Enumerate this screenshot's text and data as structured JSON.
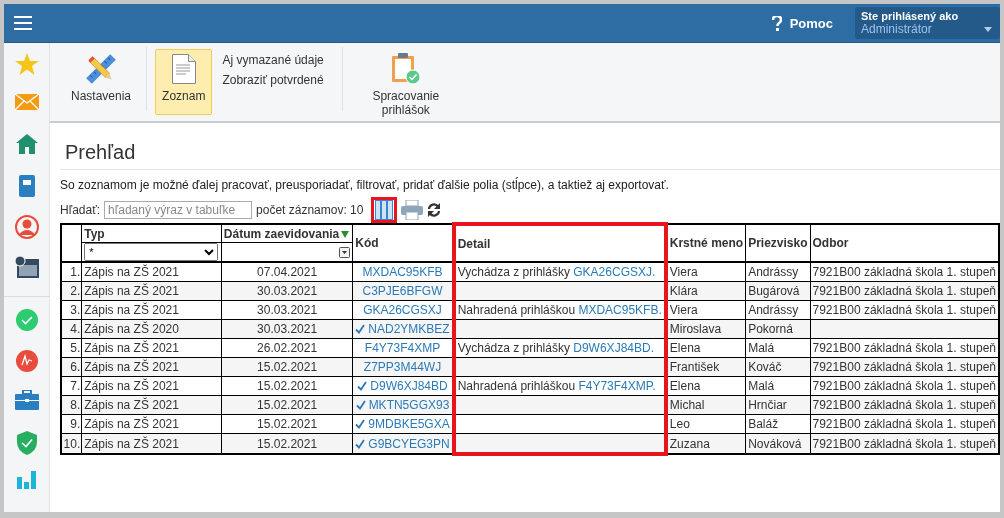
{
  "topbar": {
    "help": "Pomoc",
    "user_caption": "Ste prihlásený ako",
    "user_name": "Administrátor"
  },
  "ribbon": [
    {
      "kind": "settings",
      "label": "Nastavenia",
      "selected": false
    },
    {
      "kind": "list",
      "label": "Zoznam",
      "selected": true
    },
    {
      "kind": "links",
      "links": [
        "Aj vymazané údaje",
        "Zobraziť potvrdené"
      ]
    },
    {
      "kind": "processing",
      "label": "Spracovanie prihlášok",
      "selected": false
    }
  ],
  "page": {
    "title": "Prehľad",
    "description": "So zoznamom je možné ďalej pracovať, preusporiadať, filtrovať, pridať ďalšie polia (stĺpce), a taktiež aj exportovať.",
    "search_label": "Hľadať:",
    "search_placeholder": "hľadaný výraz v tabuľke",
    "count": "počet záznamov: 10",
    "columns_button_highlighted": true
  },
  "table": {
    "columns": [
      {
        "label": "Typ",
        "kind": "select",
        "filter_value": "*",
        "highlighted": false
      },
      {
        "label": "Dátum zaevidovania",
        "kind": "date",
        "sorted": true,
        "highlighted": false
      },
      {
        "label": "Kód",
        "highlighted": false
      },
      {
        "label": "Detail",
        "highlighted": true
      },
      {
        "label": "Krstné meno",
        "highlighted": false
      },
      {
        "label": "Priezvisko",
        "highlighted": false
      },
      {
        "label": "Odbor",
        "highlighted": false
      }
    ],
    "rows": [
      {
        "number": "1.",
        "type": "Zápis na ZŠ 2021",
        "date": "07.04.2021",
        "code": "MXDAC95KFB",
        "confirmed": false,
        "detail_text": "Vychádza z prihlášky",
        "detail_link": "GKA26CGSXJ.",
        "first_name": "Viera",
        "last_name": "Andrássy",
        "department": "7921B00 základná škola 1. stupeň"
      },
      {
        "number": "2.",
        "type": "Zápis na ZŠ 2021",
        "date": "30.03.2021",
        "code": "C3PJE6BFGW",
        "confirmed": false,
        "first_name": "Klára",
        "last_name": "Bugárová",
        "department": "7921B00 základná škola 1. stupeň"
      },
      {
        "number": "3.",
        "type": "Zápis na ZŠ 2021",
        "date": "30.03.2021",
        "code": "GKA26CGSXJ",
        "confirmed": false,
        "detail_text": "Nahradená prihláškou",
        "detail_link": "MXDAC95KFB.",
        "first_name": "Viera",
        "last_name": "Andrássy",
        "department": "7921B00 základná škola 1. stupeň"
      },
      {
        "number": "4.",
        "type": "Zápis na ZŠ 2020",
        "date": "30.03.2021",
        "code": "NAD2YMKBEZ",
        "confirmed": true,
        "first_name": "Miroslava",
        "last_name": "Pokorná"
      },
      {
        "number": "5.",
        "type": "Zápis na ZŠ 2021",
        "date": "26.02.2021",
        "code": "F4Y73F4XMP",
        "confirmed": false,
        "detail_text": "Vychádza z prihlášky",
        "detail_link": "D9W6XJ84BD.",
        "first_name": "Elena",
        "last_name": "Malá",
        "department": "7921B00 základná škola 1. stupeň"
      },
      {
        "number": "6.",
        "type": "Zápis na ZŠ 2021",
        "date": "15.02.2021",
        "code": "Z7PP3M44WJ",
        "confirmed": false,
        "first_name": "František",
        "last_name": "Kováč",
        "department": "7921B00 základná škola 1. stupeň"
      },
      {
        "number": "7.",
        "type": "Zápis na ZŠ 2021",
        "date": "15.02.2021",
        "code": "D9W6XJ84BD",
        "confirmed": true,
        "detail_text": "Nahradená prihláškou",
        "detail_link": "F4Y73F4XMP.",
        "first_name": "Elena",
        "last_name": "Malá",
        "department": "7921B00 základná škola 1. stupeň"
      },
      {
        "number": "8.",
        "type": "Zápis na ZŠ 2021",
        "date": "15.02.2021",
        "code": "MKTN5GGX93",
        "confirmed": true,
        "first_name": "Michal",
        "last_name": "Hrnčiar",
        "department": "7921B00 základná škola 1. stupeň"
      },
      {
        "number": "9.",
        "type": "Zápis na ZŠ 2021",
        "date": "15.02.2021",
        "code": "9MDBKE5GXA",
        "confirmed": true,
        "first_name": "Leo",
        "last_name": "Baláž",
        "department": "7921B00 základná škola 1. stupeň"
      },
      {
        "number": "10.",
        "type": "Zápis na ZŠ 2021",
        "date": "15.02.2021",
        "code": "G9BCYEG3PN",
        "confirmed": true,
        "first_name": "Zuzana",
        "last_name": "Nováková",
        "department": "7921B00 základná škola 1. stupeň"
      }
    ]
  }
}
